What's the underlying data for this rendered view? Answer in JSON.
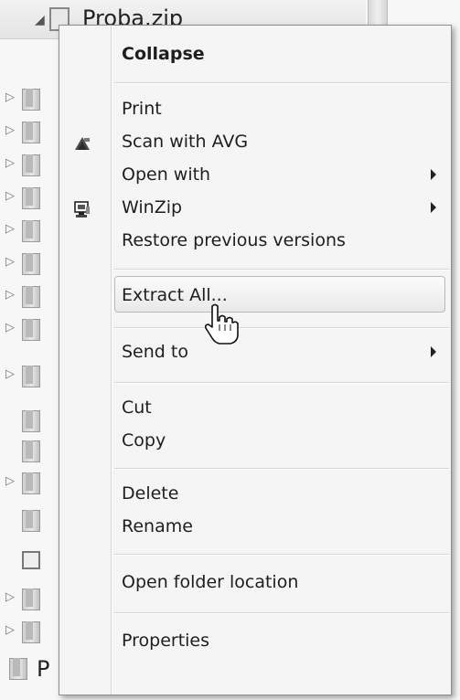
{
  "tree": {
    "title": "Proba.zip",
    "bottom_item_label": "P"
  },
  "menu": {
    "items": {
      "collapse": "Collapse",
      "print": "Print",
      "scan_avg": "Scan with AVG",
      "open_with": "Open with",
      "winzip": "WinZip",
      "restore": "Restore previous versions",
      "extract_all": "Extract All...",
      "send_to": "Send to",
      "cut": "Cut",
      "copy": "Copy",
      "delete": "Delete",
      "rename": "Rename",
      "open_location": "Open folder location",
      "properties": "Properties"
    },
    "hovered_item": "extract_all"
  },
  "icons": {
    "avg": "avg-scan-icon",
    "winzip": "winzip-icon",
    "cursor": "hand-pointer-icon"
  }
}
